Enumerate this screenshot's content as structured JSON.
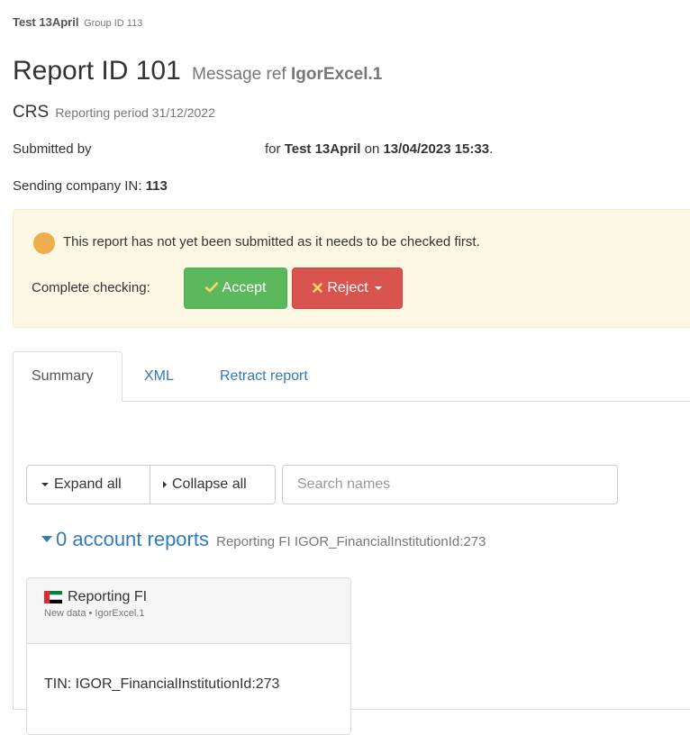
{
  "group": {
    "name": "Test 13April",
    "id_label": "Group ID 113"
  },
  "report": {
    "title": "Report ID 101",
    "message_ref_label": "Message ref",
    "message_ref": "IgorExcel.1",
    "type": "CRS",
    "period_label": "Reporting period 31/12/2022"
  },
  "submission": {
    "submitted_by_label": "Submitted by",
    "for_label": "for",
    "for_value": "Test 13April",
    "on_label": "on",
    "datetime": "13/04/2023 15:33",
    "trailing": "."
  },
  "sending_company": {
    "label": "Sending company IN:",
    "value": "113"
  },
  "alert": {
    "message": "This report has not yet been submitted as it needs to be checked first.",
    "complete_checking_label": "Complete checking:",
    "accept_label": "Accept",
    "reject_label": "Reject"
  },
  "tabs": [
    {
      "label": "Summary",
      "active": true
    },
    {
      "label": "XML",
      "active": false
    },
    {
      "label": "Retract report",
      "active": false
    }
  ],
  "toolbar": {
    "expand_all": "Expand all",
    "collapse_all": "Collapse all",
    "search_placeholder": "Search names"
  },
  "accounts": {
    "heading": "0 account reports",
    "sub": "Reporting FI IGOR_FinancialInstitutionId:273"
  },
  "fi_panel": {
    "title": "Reporting FI",
    "sub": "New data • IgorExcel.1",
    "tin": "TIN: IGOR_FinancialInstitutionId:273"
  },
  "colors": {
    "accept": "#5cb85c",
    "reject": "#d9534f",
    "warning_bg": "#fcf8e3",
    "warning_dot": "#f0ad4e",
    "link": "#337ab7"
  }
}
